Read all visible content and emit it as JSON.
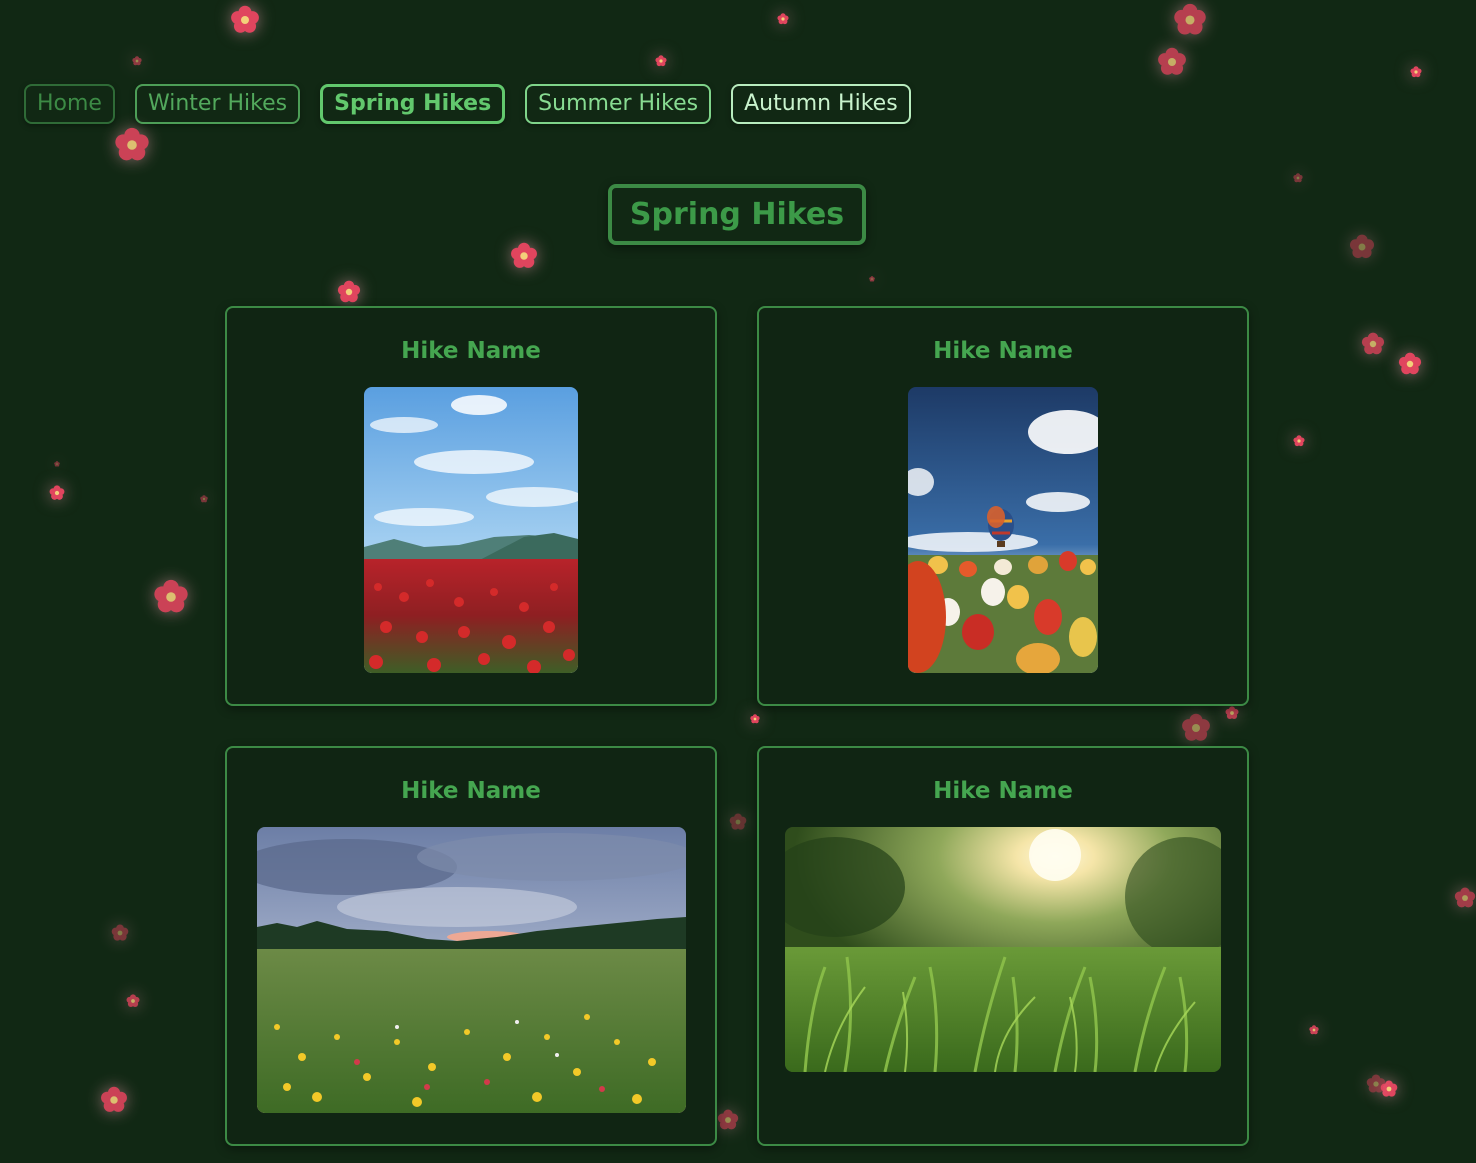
{
  "nav": {
    "items": [
      {
        "label": "Home"
      },
      {
        "label": "Winter Hikes"
      },
      {
        "label": "Spring Hikes"
      },
      {
        "label": "Summer Hikes"
      },
      {
        "label": "Autumn Hikes"
      }
    ],
    "active": "Spring Hikes"
  },
  "page_title": "Spring Hikes",
  "cards": [
    {
      "name": "Hike Name",
      "image": "poppy field under blue sky with mountains"
    },
    {
      "name": "Hike Name",
      "image": "tulips with hot air balloons in sky"
    },
    {
      "name": "Hike Name",
      "image": "wildflower meadow with pine forest at sunset"
    },
    {
      "name": "Hike Name",
      "image": "sunlit grass close-up"
    }
  ],
  "colors": {
    "background": "#112814",
    "accent": "#3c8a45",
    "active": "#62c86d",
    "flower": "#e0455e"
  }
}
